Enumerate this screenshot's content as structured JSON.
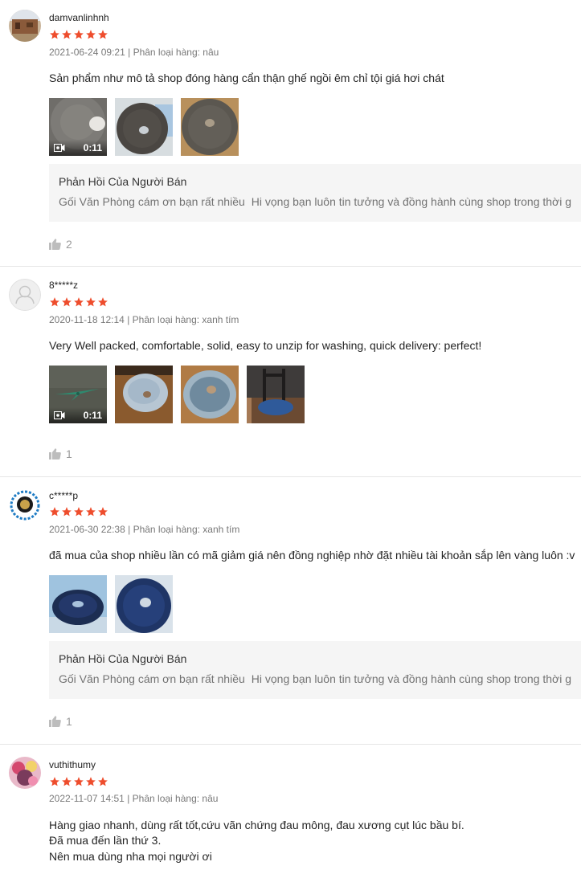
{
  "reviews": [
    {
      "username": "damvanlinhnh",
      "rating": 5,
      "date": "2021-06-24 09:21",
      "separator": "|",
      "variant": "Phân loại hàng: nâu",
      "text_lines": [
        "Sản phẩm như mô tả shop đóng hàng cẩn thận ghế ngồi êm chỉ tội giá hơi chát"
      ],
      "video_duration": "0:11",
      "seller_reply": {
        "title": "Phản Hồi Của Người Bán",
        "text_before": "Gối Văn Phòng cám ơn bạn rất nhiều",
        "text_after": "Hi vọng bạn luôn tin tưởng và đồng hành cùng shop trong thời g"
      },
      "like_count": "2"
    },
    {
      "username": "8*****z",
      "rating": 5,
      "date": "2020-11-18 12:14",
      "separator": "|",
      "variant": "Phân loại hàng: xanh tím",
      "text_lines": [
        "Very Well packed, comfortable, solid, easy to unzip for washing, quick delivery: perfect!"
      ],
      "video_duration": "0:11",
      "like_count": "1"
    },
    {
      "username": "c*****p",
      "rating": 5,
      "date": "2021-06-30 22:38",
      "separator": "|",
      "variant": "Phân loại hàng: xanh tím",
      "text_lines": [
        "đã mua của shop nhiều lần có mã giảm giá nên đồng nghiệp nhờ đặt nhiều tài khoản sắp lên vàng luôn :v"
      ],
      "seller_reply": {
        "title": "Phản Hồi Của Người Bán",
        "text_before": "Gối Văn Phòng cám ơn bạn rất nhiều",
        "text_after": "Hi vọng bạn luôn tin tưởng và đồng hành cùng shop trong thời g"
      },
      "like_count": "1"
    },
    {
      "username": "vuthithumy",
      "rating": 5,
      "date": "2022-11-07 14:51",
      "separator": "|",
      "variant": "Phân loại hàng: nâu",
      "text_lines": [
        "Hàng giao nhanh, dùng rất tốt,cứu vãn chứng đau mông, đau xương cụt lúc bầu bí.",
        "Đã mua đến lần thứ 3.",
        "Nên mua dùng nha mọi người ơi"
      ]
    }
  ],
  "colors": {
    "star": "#ee4d2d",
    "reply_bg": "#f5f5f5",
    "divider": "#e6e6e6",
    "heart": "#d0364a"
  },
  "icons": {
    "star": "star-icon",
    "video": "video-camera-icon",
    "like": "thumbs-up-icon",
    "heart": "heart-icon",
    "default_avatar": "user-silhouette-icon"
  }
}
